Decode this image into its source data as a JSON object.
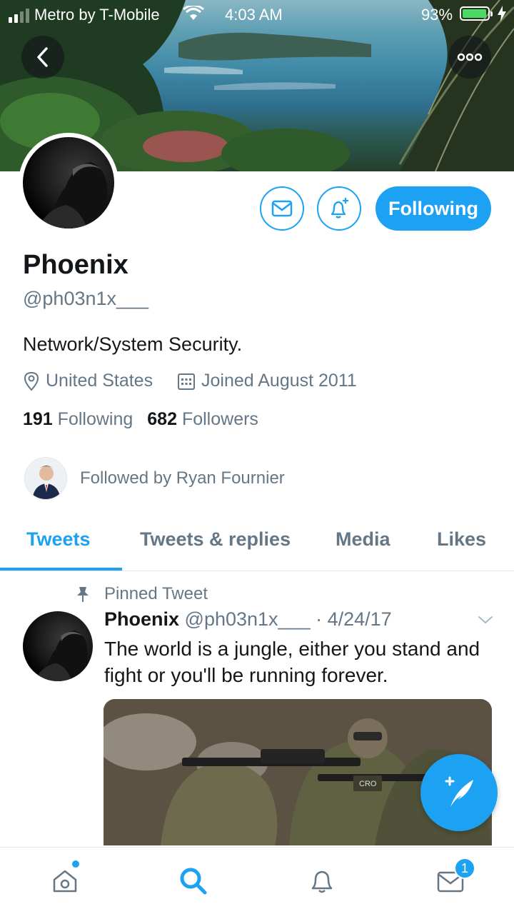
{
  "status_bar": {
    "carrier": "Metro by T-Mobile",
    "time": "4:03 AM",
    "battery": "93%",
    "battery_level": 0.93
  },
  "profile": {
    "name": "Phoenix",
    "handle": "@ph03n1x___",
    "bio": "Network/System Security.",
    "location": "United States",
    "joined": "Joined August 2011",
    "following_count": "191",
    "following_label": "Following",
    "followers_count": "682",
    "followers_label": "Followers",
    "followed_by": "Followed by Ryan Fournier",
    "following_button": "Following"
  },
  "tabs": [
    {
      "label": "Tweets",
      "active": true
    },
    {
      "label": "Tweets & replies",
      "active": false
    },
    {
      "label": "Media",
      "active": false
    },
    {
      "label": "Likes",
      "active": false
    }
  ],
  "pinned_tweet": {
    "pinned_label": "Pinned Tweet",
    "author_name": "Phoenix",
    "author_handle": "@ph03n1x___",
    "date": "· 4/24/17",
    "text": "The world is a jungle, either you stand and fight or you'll be running forever.",
    "media_patch": "CRO"
  },
  "bottom_nav": {
    "messages_badge": "1"
  },
  "colors": {
    "accent": "#1da1f2",
    "text_primary": "#14171a",
    "text_secondary": "#657786",
    "divider": "#e1e8ed"
  }
}
